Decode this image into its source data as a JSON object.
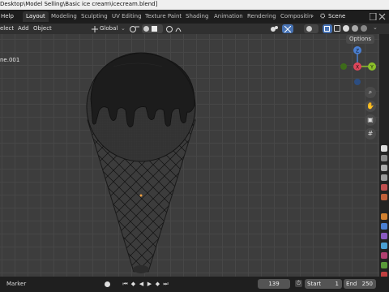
{
  "window": {
    "path": "Desktop\\Model Selling\\Basic ice cream\\icecream.blend]"
  },
  "menubar": {
    "help": "Help"
  },
  "workspaces": [
    {
      "label": "Layout",
      "active": true
    },
    {
      "label": "Modeling"
    },
    {
      "label": "Sculpting"
    },
    {
      "label": "UV Editing"
    },
    {
      "label": "Texture Paint"
    },
    {
      "label": "Shading"
    },
    {
      "label": "Animation"
    },
    {
      "label": "Rendering"
    },
    {
      "label": "Compositin"
    }
  ],
  "scene": {
    "name": "Scene"
  },
  "header": {
    "select": "elect",
    "add": "Add",
    "object": "Object",
    "orientation": "Global"
  },
  "viewport": {
    "object_label": "ne.001",
    "options": "Options"
  },
  "gizmo": {
    "z": "Z",
    "x": "X",
    "y": "Y"
  },
  "timeline": {
    "marker": "Marker",
    "current_frame": "139",
    "start_label": "Start",
    "start_value": "1",
    "end_label": "End",
    "end_value": "250"
  },
  "colors": {
    "accent": "#4772b3",
    "x_axis": "#e0455a",
    "y_axis": "#8bbf2a",
    "z_axis": "#4a7fd2"
  }
}
